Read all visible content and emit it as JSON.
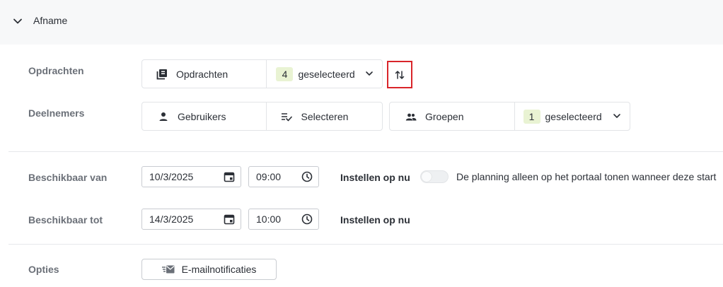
{
  "section": {
    "title": "Afname"
  },
  "rows": {
    "opdrachten": {
      "label": "Opdrachten",
      "picker_label": "Opdrachten",
      "selected_count": "4",
      "selected_text": "geselecteerd"
    },
    "deelnemers": {
      "label": "Deelnemers",
      "users_label": "Gebruikers",
      "select_label": "Selecteren",
      "groups_label": "Groepen",
      "selected_count": "1",
      "selected_text": "geselecteerd"
    },
    "beschikbaar_van": {
      "label": "Beschikbaar van",
      "date": "10/3/2025",
      "time": "09:00",
      "now_label": "Instellen op nu",
      "toggle_label": "De planning alleen op het portaal tonen wanneer deze start"
    },
    "beschikbaar_tot": {
      "label": "Beschikbaar tot",
      "date": "14/3/2025",
      "time": "10:00",
      "now_label": "Instellen op nu"
    },
    "opties": {
      "label": "Opties",
      "email_button": "E-mailnotificaties"
    }
  },
  "icons": {
    "section_toggle": "chevron-down-icon",
    "opdrachten": "library-books-icon",
    "sort": "swap-vertical-icon",
    "users": "person-icon",
    "select": "checklist-icon",
    "groups": "group-icon",
    "dropdown": "chevron-down-icon",
    "calendar": "calendar-icon",
    "clock": "clock-icon",
    "email": "email-fast-icon"
  },
  "colors": {
    "badge_bg": "#e9f3d3",
    "highlight_border": "#d9252a",
    "header_bg": "#f7f8f9"
  }
}
